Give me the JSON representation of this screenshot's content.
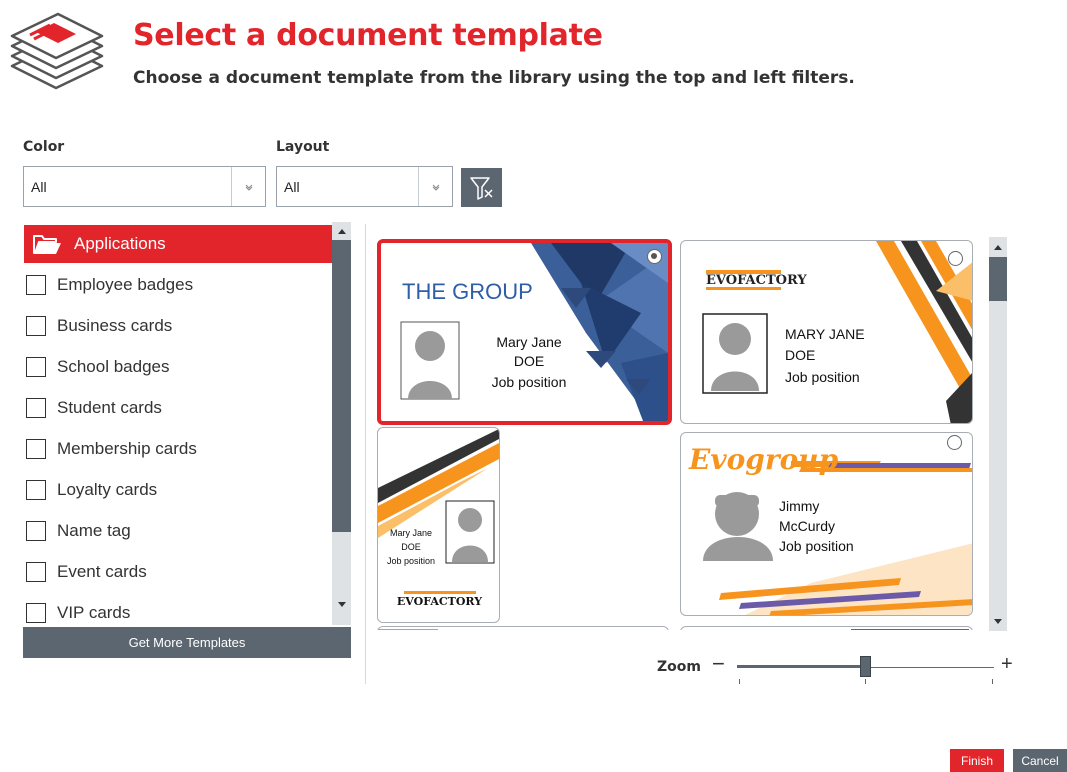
{
  "header": {
    "title": "Select a document template",
    "subtitle": "Choose a document template from the library using the top and left filters."
  },
  "filters": {
    "color": {
      "label": "Color",
      "value": "All"
    },
    "layout": {
      "label": "Layout",
      "value": "All"
    }
  },
  "categories": {
    "header": "Applications",
    "items": [
      {
        "label": "Employee badges",
        "checked": false
      },
      {
        "label": "Business cards",
        "checked": false
      },
      {
        "label": "School badges",
        "checked": false
      },
      {
        "label": "Student cards",
        "checked": false
      },
      {
        "label": "Membership cards",
        "checked": false
      },
      {
        "label": "Loyalty cards",
        "checked": false
      },
      {
        "label": "Name tag",
        "checked": false
      },
      {
        "label": "Event cards",
        "checked": false
      },
      {
        "label": "VIP cards",
        "checked": false
      }
    ]
  },
  "more_templates_label": "Get More Templates",
  "templates": [
    {
      "company": "THE GROUP",
      "lines": [
        "Mary Jane",
        "DOE",
        "Job position"
      ],
      "selected": true
    },
    {
      "company": "EVOFACTORY",
      "lines": [
        "MARY JANE",
        "DOE",
        "Job position"
      ],
      "selected": false
    },
    {
      "company": "EVOFACTORY",
      "lines": [
        "Mary Jane",
        "DOE",
        "Job position"
      ],
      "selected": false
    },
    {
      "company": "Evogroup",
      "lines": [
        "Jimmy",
        "McCurdy",
        "Job position"
      ],
      "selected": false
    }
  ],
  "zoom": {
    "label": "Zoom",
    "minus": "−",
    "plus": "+",
    "level": 0.5
  },
  "buttons": {
    "finish": "Finish",
    "cancel": "Cancel"
  },
  "colors": {
    "accent": "#e2242b",
    "dark": "#5c6670",
    "navy": "#2e4a7d",
    "orange": "#f7941d"
  }
}
